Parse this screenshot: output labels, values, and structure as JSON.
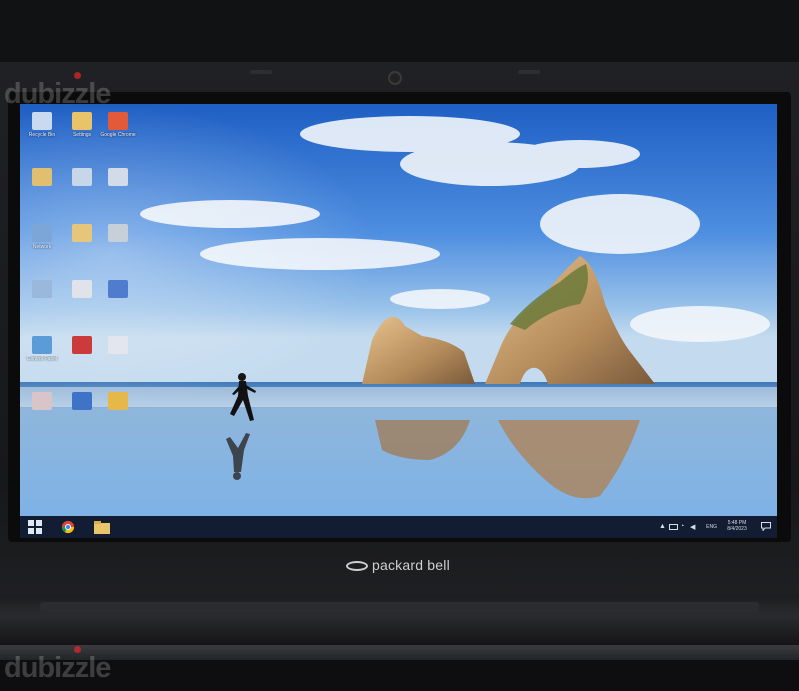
{
  "desktop": {
    "icons": [
      {
        "label": "Recycle Bin",
        "icon": "recycle-bin-icon",
        "color": "#c9d9ef"
      },
      {
        "label": "Settings",
        "icon": "folder-icon",
        "color": "#e8c36a"
      },
      {
        "label": "Google Chrome",
        "icon": "chrome-icon",
        "color": "#e35a3a"
      },
      {
        "label": "",
        "icon": "folder-icon",
        "color": "#e0c070"
      },
      {
        "label": "",
        "icon": "file-icon",
        "color": "#c8d6ea"
      },
      {
        "label": "",
        "icon": "shortcut-icon",
        "color": "#d3dbe8"
      },
      {
        "label": "Network",
        "icon": "network-icon",
        "color": "#7ca6d8"
      },
      {
        "label": "",
        "icon": "folder-icon",
        "color": "#e6c67a"
      },
      {
        "label": "",
        "icon": "app-icon",
        "color": "#c7cfd9"
      },
      {
        "label": "",
        "icon": "computer-icon",
        "color": "#9ab8db"
      },
      {
        "label": "",
        "icon": "document-icon",
        "color": "#e0e4ea"
      },
      {
        "label": "",
        "icon": "word-document-icon",
        "color": "#4f7ccf"
      },
      {
        "label": "Control Panel",
        "icon": "control-panel-icon",
        "color": "#5b9bd8"
      },
      {
        "label": "",
        "icon": "antivirus-icon",
        "color": "#cc3b3b"
      },
      {
        "label": "",
        "icon": "file-icon",
        "color": "#e3e6ec"
      },
      {
        "label": "",
        "icon": "image-file-icon",
        "color": "#d9c5c9"
      },
      {
        "label": "",
        "icon": "powershell-icon",
        "color": "#3f73c8"
      },
      {
        "label": "",
        "icon": "tool-icon",
        "color": "#e6b84a"
      }
    ]
  },
  "taskbar": {
    "start_icon": "windows-start-icon",
    "pinned": [
      {
        "icon": "chrome-icon"
      },
      {
        "icon": "file-explorer-icon"
      }
    ],
    "tray": {
      "language": "ENG",
      "time": "5:48 PM",
      "date": "8/4/2023"
    }
  },
  "brand": {
    "name": "packard bell"
  },
  "watermark": {
    "text": "dubizzle"
  }
}
